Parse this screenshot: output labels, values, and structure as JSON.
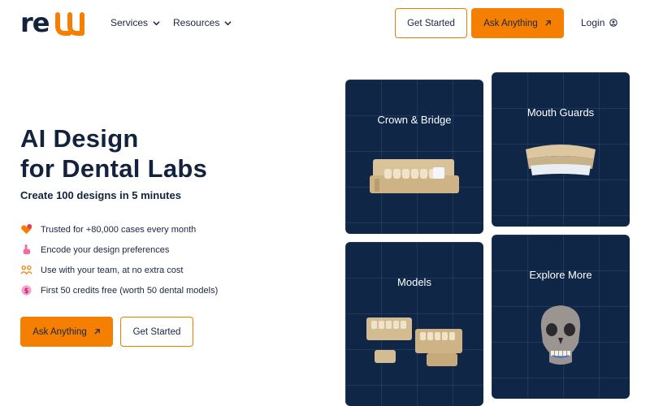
{
  "header": {
    "logo_text": "relu",
    "nav": [
      {
        "label": "Services"
      },
      {
        "label": "Resources"
      }
    ],
    "get_started_label": "Get Started",
    "ask_anything_label": "Ask Anything",
    "login_label": "Login"
  },
  "hero": {
    "title_line1": "AI Design",
    "title_line2": "for Dental Labs",
    "subtitle": "Create 100 designs in 5 minutes",
    "features": [
      {
        "text": "Trusted for +80,000 cases every month",
        "icon": "heart-badge-icon"
      },
      {
        "text": "Encode your design preferences",
        "icon": "pointer-hand-icon"
      },
      {
        "text": "Use with your team, at no extra cost",
        "icon": "team-icon"
      },
      {
        "text": "First 50 credits free (worth 50 dental models)",
        "icon": "coin-icon"
      }
    ],
    "ask_anything_label": "Ask Anything",
    "get_started_label": "Get Started"
  },
  "cards": [
    {
      "title": "Crown & Bridge"
    },
    {
      "title": "Mouth Guards"
    },
    {
      "title": "Models"
    },
    {
      "title": "Explore More"
    }
  ],
  "colors": {
    "accent": "#f57f00",
    "navy": "#13233d",
    "card_bg": "#0f2647"
  }
}
